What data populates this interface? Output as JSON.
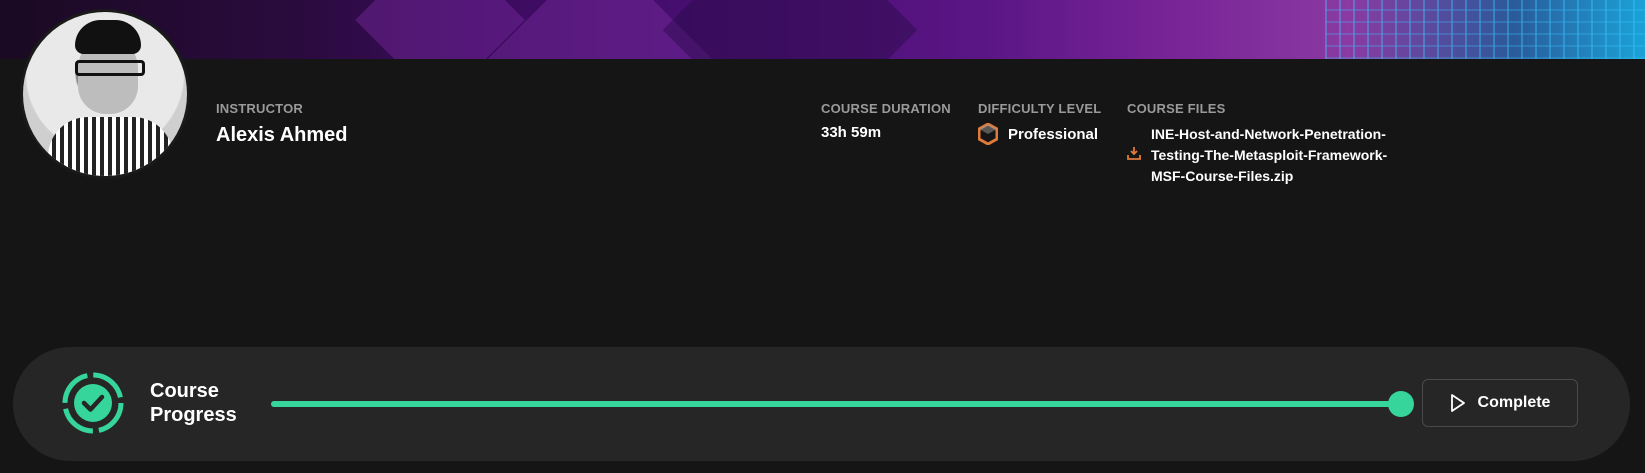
{
  "instructor": {
    "label": "INSTRUCTOR",
    "name": "Alexis Ahmed"
  },
  "course_duration": {
    "label": "COURSE DURATION",
    "value": "33h 59m"
  },
  "difficulty": {
    "label": "DIFFICULTY LEVEL",
    "value": "Professional",
    "icon": "hexagon-icon",
    "icon_color": "#e07a3a"
  },
  "course_files": {
    "label": "COURSE FILES",
    "file_name": "INE-Host-and-Network-Penetration-Testing-The-Metasploit-Framework-MSF-Course-Files.zip",
    "icon": "download-icon",
    "icon_color": "#e07a3a"
  },
  "progress": {
    "label": "Course Progress",
    "value_fraction": 1.0,
    "accent_color": "#35d59b",
    "button_label": "Complete"
  }
}
